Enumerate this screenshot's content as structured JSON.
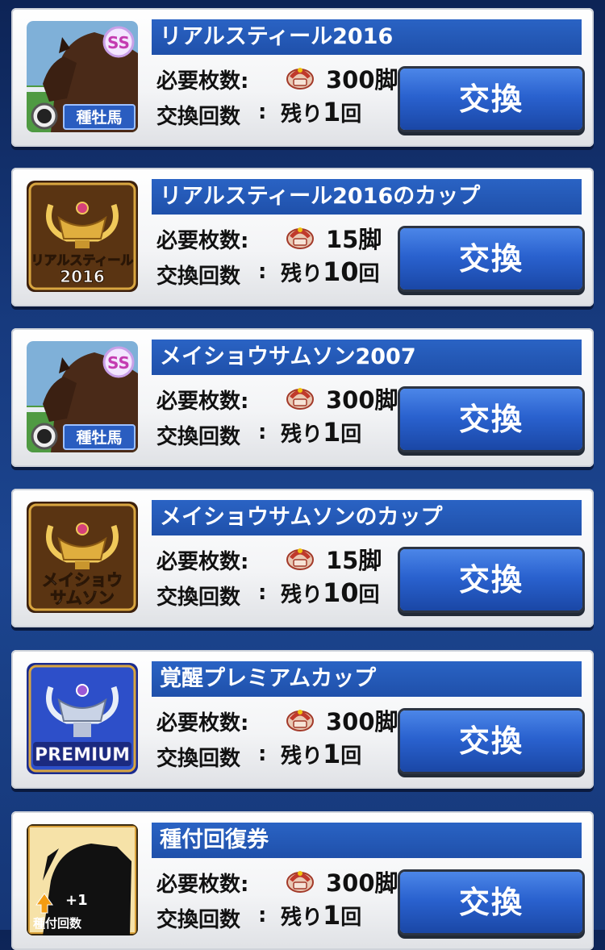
{
  "labels": {
    "required": "必要枚数:",
    "exchange_count": "交換回数",
    "colon": ":",
    "remain_prefix": "残り",
    "remain_suffix": "回",
    "button": "交換"
  },
  "items": [
    {
      "title": "リアルスティール2016",
      "cost": "300脚",
      "remaining": "1",
      "thumb": "stallion-ss",
      "badge": "SS",
      "tag": "種牡馬"
    },
    {
      "title": "リアルスティール2016のカップ",
      "cost": "15脚",
      "remaining": "10",
      "thumb": "gold-cup",
      "cup_text": [
        "リアルスティール",
        "2016"
      ]
    },
    {
      "title": "メイショウサムソン2007",
      "cost": "300脚",
      "remaining": "1",
      "thumb": "stallion-ss",
      "badge": "SS",
      "tag": "種牡馬"
    },
    {
      "title": "メイショウサムソンのカップ",
      "cost": "15脚",
      "remaining": "10",
      "thumb": "gold-cup",
      "cup_text": [
        "メイショウ",
        "サムソン"
      ]
    },
    {
      "title": "覚醒プレミアムカップ",
      "cost": "300脚",
      "remaining": "1",
      "thumb": "premium-cup",
      "cup_text": [
        "PREMIUM"
      ]
    },
    {
      "title": "種付回復券",
      "cost": "300脚",
      "remaining": "1",
      "thumb": "ticket",
      "ticket_text": [
        "+1",
        "種付回数"
      ]
    }
  ],
  "colors": {
    "title_bar": "#1f50aa",
    "button": "#2a62cf",
    "background": "#173a7e"
  }
}
